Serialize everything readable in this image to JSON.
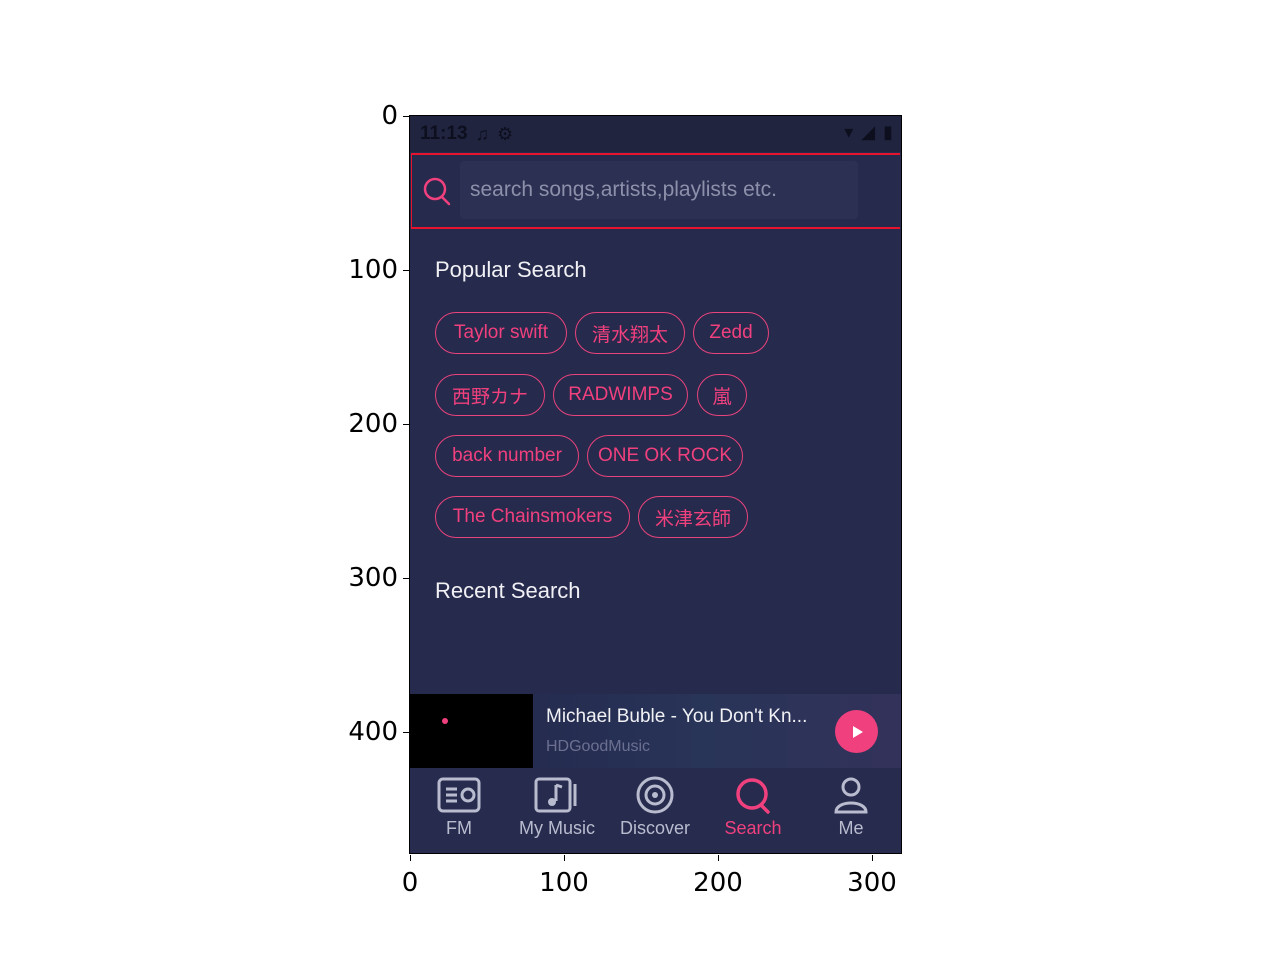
{
  "axes": {
    "y_ticks": [
      "0",
      "100",
      "200",
      "300",
      "400"
    ],
    "x_ticks": [
      "0",
      "100",
      "200",
      "300"
    ]
  },
  "status_bar": {
    "time": "11:13"
  },
  "search": {
    "placeholder": "search songs,artists,playlists etc."
  },
  "popular": {
    "title": "Popular Search",
    "chips": [
      "Taylor swift",
      "清水翔太",
      "Zedd",
      "西野カナ",
      "RADWIMPS",
      "嵐",
      "back number",
      "ONE OK ROCK",
      "The Chainsmokers",
      "米津玄師"
    ]
  },
  "recent": {
    "title": "Recent Search"
  },
  "mini_player": {
    "title": "Michael Buble - You Don't Kn...",
    "artist": "HDGoodMusic"
  },
  "nav": {
    "items": [
      {
        "label": "FM",
        "icon": "radio-icon",
        "active": false
      },
      {
        "label": "My Music",
        "icon": "music-note-icon",
        "active": false
      },
      {
        "label": "Discover",
        "icon": "disc-icon",
        "active": false
      },
      {
        "label": "Search",
        "icon": "search-icon",
        "active": true
      },
      {
        "label": "Me",
        "icon": "person-icon",
        "active": false
      }
    ]
  },
  "colors": {
    "accent": "#f0407e",
    "background": "#262a4c",
    "highlight_border": "#e8142e"
  }
}
